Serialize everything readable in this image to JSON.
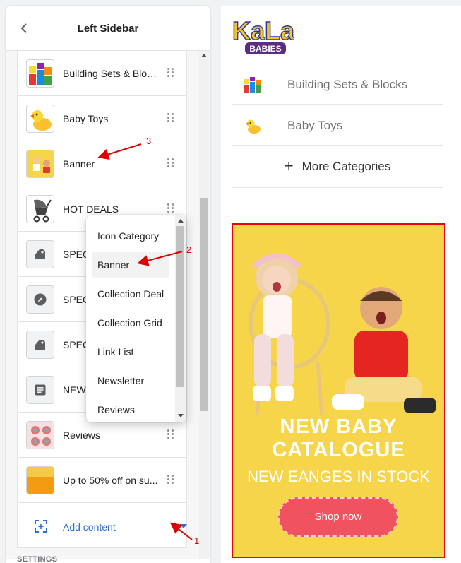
{
  "header": {
    "title": "Left Sidebar",
    "back_icon": "chevron-left-icon"
  },
  "sections": [
    {
      "label": "Building Sets & Blocks",
      "thumb": "blocks"
    },
    {
      "label": "Baby Toys",
      "thumb": "duck"
    },
    {
      "label": "Banner",
      "thumb": "banner"
    },
    {
      "label": "HOT DEALS",
      "thumb": "stroller"
    },
    {
      "label": "SPECI",
      "thumb": "tag-icon"
    },
    {
      "label": "SPECI",
      "thumb": "compass-icon"
    },
    {
      "label": "SPECI",
      "thumb": "tag-icon"
    },
    {
      "label": "NEWS",
      "thumb": "newsletter-icon"
    },
    {
      "label": "Reviews",
      "thumb": "reviews"
    },
    {
      "label": "Up to 50% off on su...",
      "thumb": "orange"
    }
  ],
  "add_content": {
    "label": "Add content"
  },
  "settings_label": "SETTINGS",
  "dropdown": {
    "options": [
      "Icon Category",
      "Banner",
      "Collection Deal",
      "Collection Grid",
      "Link List",
      "Newsletter",
      "Reviews"
    ],
    "selected": "Banner"
  },
  "annotations": [
    "1",
    "2",
    "3"
  ],
  "preview": {
    "logo_top": "KaLa",
    "logo_bottom": "BABIES",
    "categories": [
      {
        "label": "Building Sets & Blocks"
      },
      {
        "label": "Baby Toys"
      }
    ],
    "more_label": "More Categories",
    "banner": {
      "title1": "NEW BABY",
      "title2": "CATALOGUE",
      "subtitle": "NEW EANGES IN STOCK",
      "button": "Shop now"
    }
  },
  "colors": {
    "accent": "#2c6ecb",
    "banner_bg": "#f7d54a",
    "button": "#f0535f",
    "annotation": "#dd0000"
  }
}
